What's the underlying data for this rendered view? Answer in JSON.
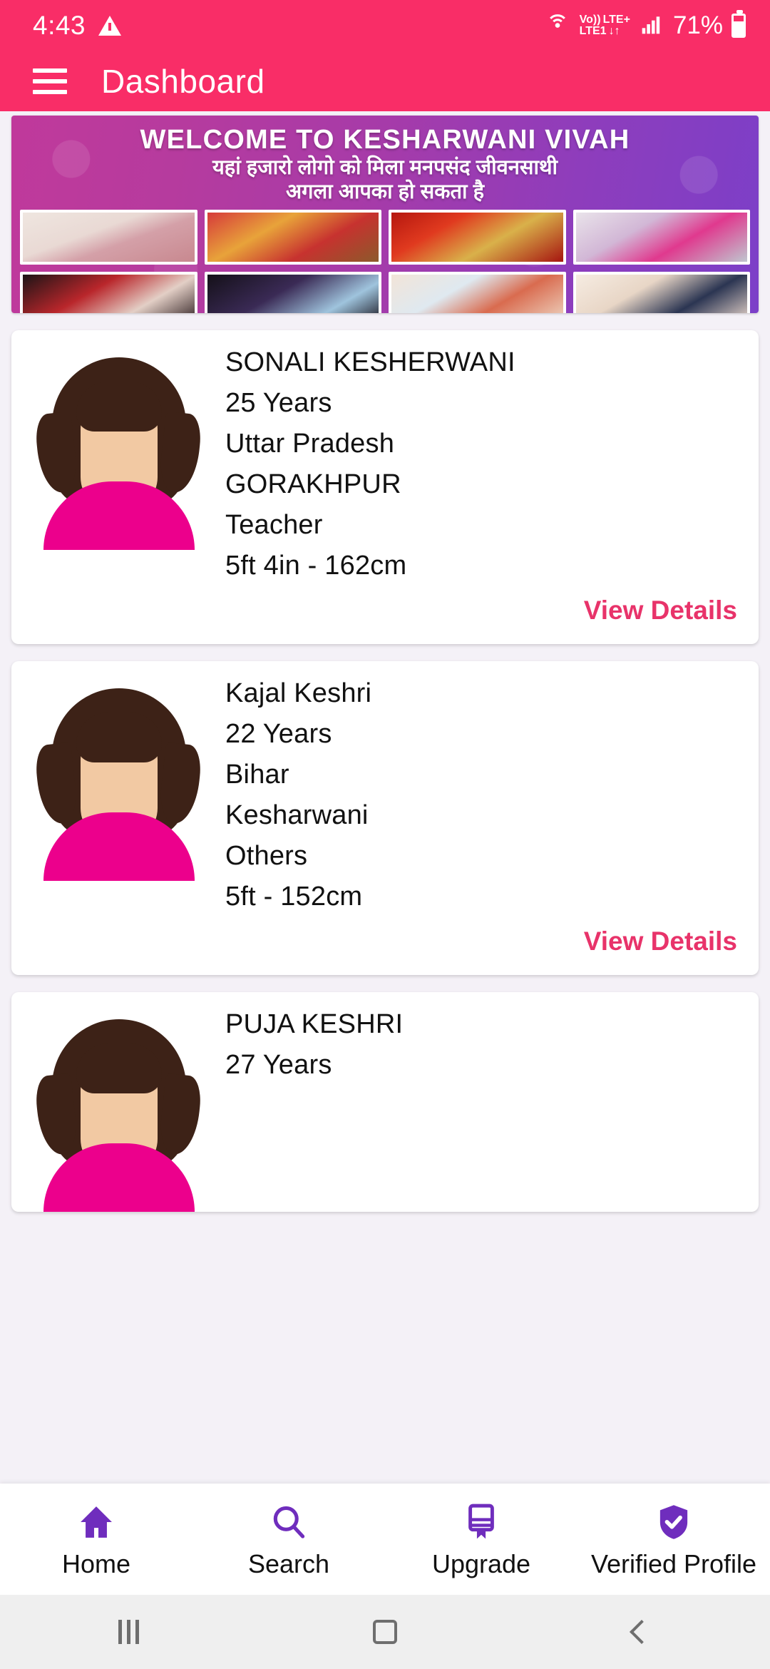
{
  "status_bar": {
    "time": "4:43",
    "warning_icon": "warning-triangle-icon",
    "hotspot_icon": "hotspot-icon",
    "volte_label": "Vo))",
    "lte_plus_label": "LTE+",
    "lte1_label": "LTE1",
    "data_arrows": "↓↑",
    "signal_icon": "signal-bars-icon",
    "battery_percent": "71%"
  },
  "app_bar": {
    "menu_icon": "hamburger-menu-icon",
    "title": "Dashboard",
    "background_color": "#F92D67"
  },
  "banner": {
    "title": "WELCOME TO KESHARWANI VIVAH",
    "subtitle_line1": "यहां हजारो लोगो को मिला मनपसंद जीवनसाथी",
    "subtitle_line2": "अगला आपका हो सकता है",
    "photo_count": 8,
    "photo_captions": [
      "wedding-photo-1",
      "wedding-photo-2",
      "wedding-photo-3",
      "wedding-photo-4",
      "wedding-photo-5",
      "wedding-photo-6",
      "wedding-photo-7",
      "wedding-photo-8"
    ]
  },
  "profiles": [
    {
      "name": "SONALI KESHERWANI",
      "age": "25 Years",
      "state": "Uttar Pradesh",
      "city": "GORAKHPUR",
      "occupation": "Teacher",
      "height": "5ft 4in - 162cm",
      "view_details_label": "View Details"
    },
    {
      "name": "Kajal Keshri",
      "age": "22 Years",
      "state": "Bihar",
      "city": "Kesharwani",
      "occupation": "Others",
      "height": "5ft - 152cm",
      "view_details_label": "View Details"
    },
    {
      "name": "PUJA KESHRI",
      "age": "27 Years"
    }
  ],
  "bottom_nav": {
    "accent_color": "#6F2DBD",
    "items": [
      {
        "label": "Home",
        "icon": "home-icon"
      },
      {
        "label": "Search",
        "icon": "search-icon"
      },
      {
        "label": "Upgrade",
        "icon": "upgrade-card-icon"
      },
      {
        "label": "Verified Profile",
        "icon": "shield-check-icon"
      }
    ]
  },
  "android_nav": {
    "recents_icon": "recents-icon",
    "home_icon": "home-square-icon",
    "back_icon": "back-chevron-icon"
  },
  "colors": {
    "primary_pink": "#F92D67",
    "link_pink": "#E8336A",
    "nav_purple": "#6F2DBD",
    "page_bg": "#F4F1F7"
  }
}
